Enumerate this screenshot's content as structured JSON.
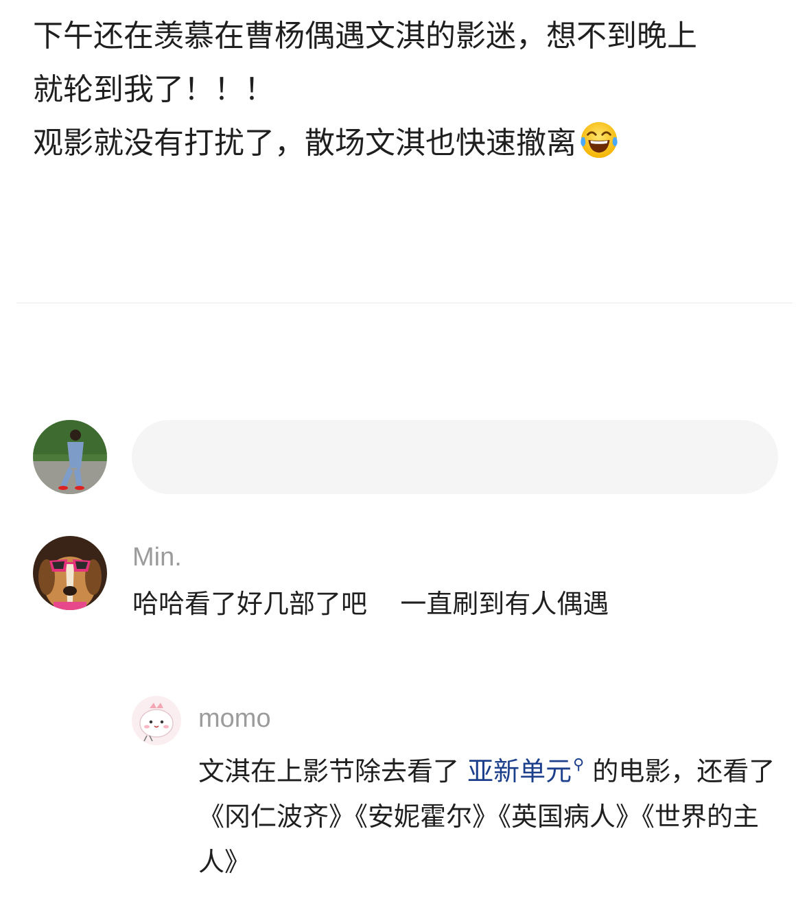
{
  "post": {
    "lines": [
      "下午还在羡慕在曹杨偶遇文淇的影迷，想不到晚上",
      "就轮到我了！！！",
      "观影就没有打扰了，散场文淇也快速撤离"
    ],
    "emoji": "face-with-tears-of-joy-icon"
  },
  "composer": {
    "placeholder": ""
  },
  "comments": [
    {
      "author": "Min.",
      "text": "哈哈看了好几部了吧    一直刷到有人偶遇",
      "reply": {
        "author": "momo",
        "text_before": "文淇在上影节除去看了 ",
        "topic_link": "亚新单元",
        "text_after": " 的电影，还看了《冈仁波齐》《安妮霍尔》《英国病人》《世界的主人》"
      }
    }
  ],
  "colors": {
    "link": "#1b3f8b",
    "username": "#9b9b9b",
    "input_bg": "#f5f5f5"
  }
}
